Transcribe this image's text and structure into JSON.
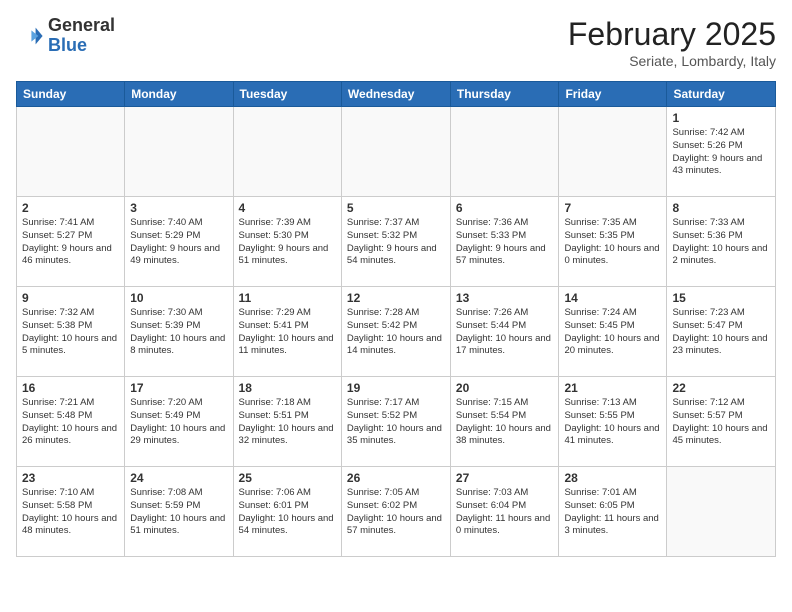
{
  "header": {
    "logo_general": "General",
    "logo_blue": "Blue",
    "month_title": "February 2025",
    "location": "Seriate, Lombardy, Italy"
  },
  "columns": [
    "Sunday",
    "Monday",
    "Tuesday",
    "Wednesday",
    "Thursday",
    "Friday",
    "Saturday"
  ],
  "weeks": [
    [
      {
        "day": "",
        "info": ""
      },
      {
        "day": "",
        "info": ""
      },
      {
        "day": "",
        "info": ""
      },
      {
        "day": "",
        "info": ""
      },
      {
        "day": "",
        "info": ""
      },
      {
        "day": "",
        "info": ""
      },
      {
        "day": "1",
        "info": "Sunrise: 7:42 AM\nSunset: 5:26 PM\nDaylight: 9 hours and 43 minutes."
      }
    ],
    [
      {
        "day": "2",
        "info": "Sunrise: 7:41 AM\nSunset: 5:27 PM\nDaylight: 9 hours and 46 minutes."
      },
      {
        "day": "3",
        "info": "Sunrise: 7:40 AM\nSunset: 5:29 PM\nDaylight: 9 hours and 49 minutes."
      },
      {
        "day": "4",
        "info": "Sunrise: 7:39 AM\nSunset: 5:30 PM\nDaylight: 9 hours and 51 minutes."
      },
      {
        "day": "5",
        "info": "Sunrise: 7:37 AM\nSunset: 5:32 PM\nDaylight: 9 hours and 54 minutes."
      },
      {
        "day": "6",
        "info": "Sunrise: 7:36 AM\nSunset: 5:33 PM\nDaylight: 9 hours and 57 minutes."
      },
      {
        "day": "7",
        "info": "Sunrise: 7:35 AM\nSunset: 5:35 PM\nDaylight: 10 hours and 0 minutes."
      },
      {
        "day": "8",
        "info": "Sunrise: 7:33 AM\nSunset: 5:36 PM\nDaylight: 10 hours and 2 minutes."
      }
    ],
    [
      {
        "day": "9",
        "info": "Sunrise: 7:32 AM\nSunset: 5:38 PM\nDaylight: 10 hours and 5 minutes."
      },
      {
        "day": "10",
        "info": "Sunrise: 7:30 AM\nSunset: 5:39 PM\nDaylight: 10 hours and 8 minutes."
      },
      {
        "day": "11",
        "info": "Sunrise: 7:29 AM\nSunset: 5:41 PM\nDaylight: 10 hours and 11 minutes."
      },
      {
        "day": "12",
        "info": "Sunrise: 7:28 AM\nSunset: 5:42 PM\nDaylight: 10 hours and 14 minutes."
      },
      {
        "day": "13",
        "info": "Sunrise: 7:26 AM\nSunset: 5:44 PM\nDaylight: 10 hours and 17 minutes."
      },
      {
        "day": "14",
        "info": "Sunrise: 7:24 AM\nSunset: 5:45 PM\nDaylight: 10 hours and 20 minutes."
      },
      {
        "day": "15",
        "info": "Sunrise: 7:23 AM\nSunset: 5:47 PM\nDaylight: 10 hours and 23 minutes."
      }
    ],
    [
      {
        "day": "16",
        "info": "Sunrise: 7:21 AM\nSunset: 5:48 PM\nDaylight: 10 hours and 26 minutes."
      },
      {
        "day": "17",
        "info": "Sunrise: 7:20 AM\nSunset: 5:49 PM\nDaylight: 10 hours and 29 minutes."
      },
      {
        "day": "18",
        "info": "Sunrise: 7:18 AM\nSunset: 5:51 PM\nDaylight: 10 hours and 32 minutes."
      },
      {
        "day": "19",
        "info": "Sunrise: 7:17 AM\nSunset: 5:52 PM\nDaylight: 10 hours and 35 minutes."
      },
      {
        "day": "20",
        "info": "Sunrise: 7:15 AM\nSunset: 5:54 PM\nDaylight: 10 hours and 38 minutes."
      },
      {
        "day": "21",
        "info": "Sunrise: 7:13 AM\nSunset: 5:55 PM\nDaylight: 10 hours and 41 minutes."
      },
      {
        "day": "22",
        "info": "Sunrise: 7:12 AM\nSunset: 5:57 PM\nDaylight: 10 hours and 45 minutes."
      }
    ],
    [
      {
        "day": "23",
        "info": "Sunrise: 7:10 AM\nSunset: 5:58 PM\nDaylight: 10 hours and 48 minutes."
      },
      {
        "day": "24",
        "info": "Sunrise: 7:08 AM\nSunset: 5:59 PM\nDaylight: 10 hours and 51 minutes."
      },
      {
        "day": "25",
        "info": "Sunrise: 7:06 AM\nSunset: 6:01 PM\nDaylight: 10 hours and 54 minutes."
      },
      {
        "day": "26",
        "info": "Sunrise: 7:05 AM\nSunset: 6:02 PM\nDaylight: 10 hours and 57 minutes."
      },
      {
        "day": "27",
        "info": "Sunrise: 7:03 AM\nSunset: 6:04 PM\nDaylight: 11 hours and 0 minutes."
      },
      {
        "day": "28",
        "info": "Sunrise: 7:01 AM\nSunset: 6:05 PM\nDaylight: 11 hours and 3 minutes."
      },
      {
        "day": "",
        "info": ""
      }
    ]
  ]
}
